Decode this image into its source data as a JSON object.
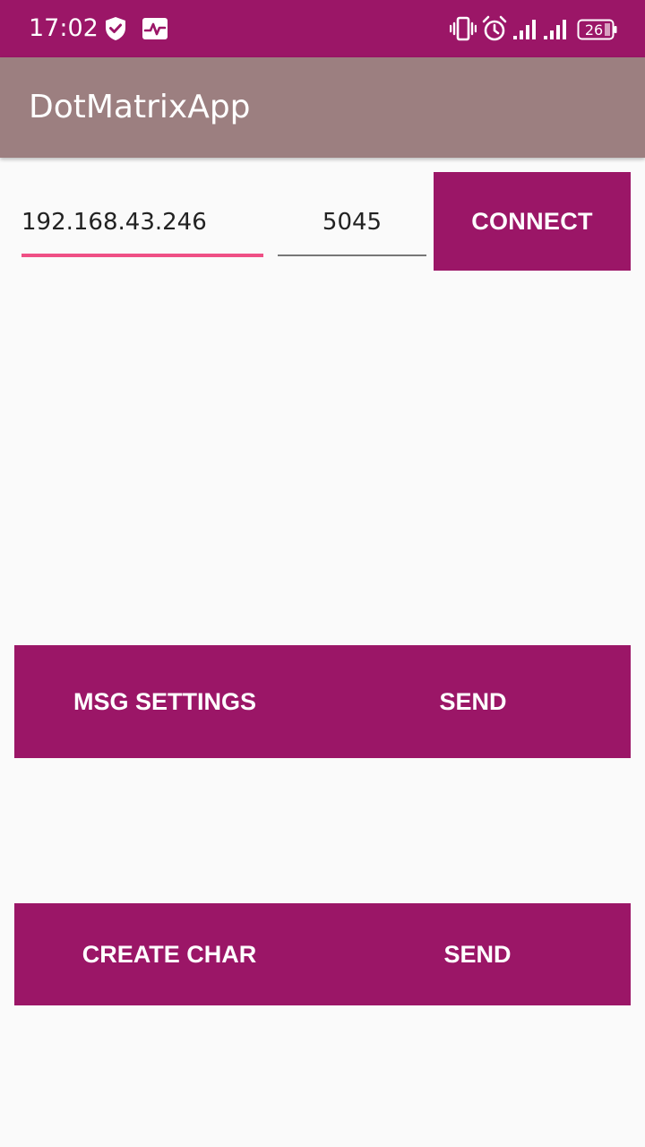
{
  "status_bar": {
    "time": "17:02",
    "battery_level": "26",
    "icons": [
      "shield-check-icon",
      "activity-monitor-icon",
      "vibrate-icon",
      "alarm-icon",
      "signal-icon",
      "signal-icon",
      "battery-icon"
    ]
  },
  "app_bar": {
    "title": "DotMatrixApp"
  },
  "connection": {
    "ip_value": "192.168.43.246",
    "port_value": "5045",
    "connect_label": "CONNECT"
  },
  "message_row": {
    "settings_label": "MSG SETTINGS",
    "send_label": "SEND"
  },
  "char_row": {
    "create_label": "CREATE CHAR",
    "send_label": "SEND"
  },
  "colors": {
    "primary_dark": "#9b1667",
    "app_bar": "#9c7f80",
    "accent": "#ef4f85",
    "background": "#fafafa"
  }
}
